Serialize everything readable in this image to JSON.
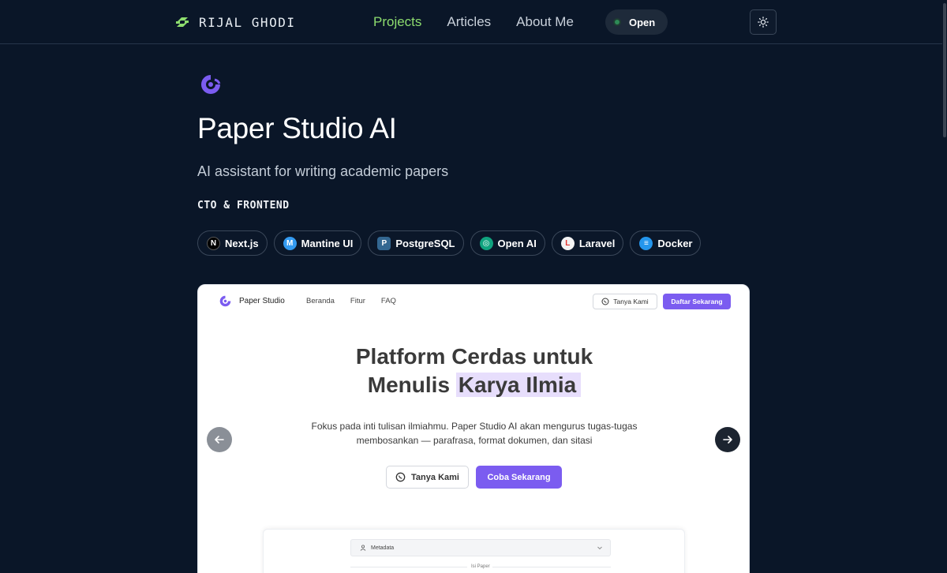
{
  "header": {
    "brand": "RIJAL GHODI",
    "nav": [
      {
        "label": "Projects"
      },
      {
        "label": "Articles"
      },
      {
        "label": "About Me"
      }
    ],
    "status": "Open",
    "icons": {
      "logo": "rg-logo-icon",
      "theme": "sun-icon"
    },
    "colors": {
      "accent": "#8ddc6e",
      "background": "#0a1628"
    }
  },
  "project": {
    "title": "Paper Studio AI",
    "description": "AI assistant for writing academic papers",
    "role": "CTO & FRONTEND",
    "tech": [
      {
        "label": "Next.js",
        "icon": "nextjs-icon"
      },
      {
        "label": "Mantine UI",
        "icon": "mantine-icon"
      },
      {
        "label": "PostgreSQL",
        "icon": "postgresql-icon"
      },
      {
        "label": "Open AI",
        "icon": "openai-icon"
      },
      {
        "label": "Laravel",
        "icon": "laravel-icon"
      },
      {
        "label": "Docker",
        "icon": "docker-icon"
      }
    ]
  },
  "screenshot": {
    "brand": "Paper Studio",
    "nav": [
      "Beranda",
      "Fitur",
      "FAQ"
    ],
    "ask_label": "Tanya Kami",
    "signup_label": "Daftar Sekarang",
    "hero_line1": "Platform Cerdas untuk",
    "hero_line2_prefix": "Menulis",
    "hero_highlight": "Karya Ilmia",
    "hero_sub_line1": "Fokus pada inti tulisan ilmiahmu. Paper Studio AI akan mengurus tugas-tugas",
    "hero_sub_line2": "membosankan — parafrasa, format dokumen, dan sitasi",
    "cta_ask": "Tanya Kami",
    "cta_try": "Coba Sekarang",
    "metadata_label": "Metadata",
    "section_label": "Isi Paper",
    "colors": {
      "primary": "#7b5cf0",
      "highlight": "#e7defc"
    }
  }
}
